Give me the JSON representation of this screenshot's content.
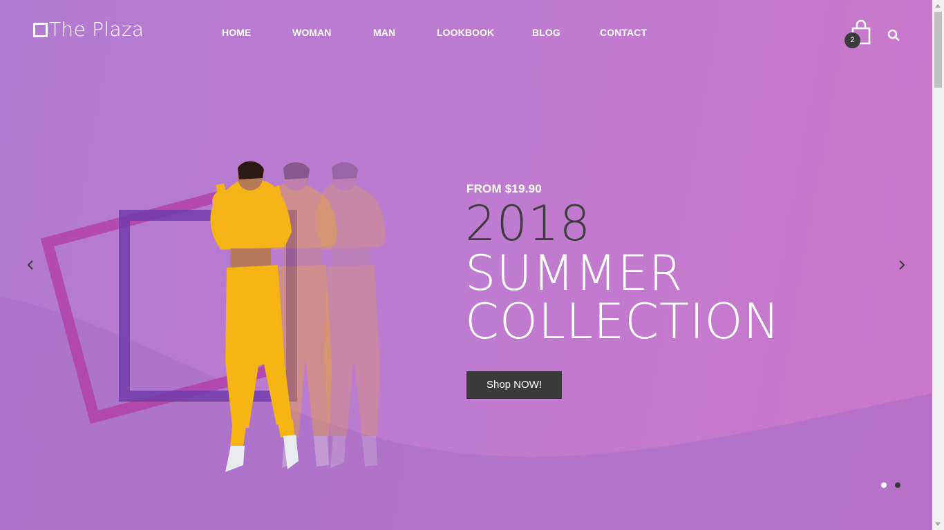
{
  "brand": {
    "name": "The Plaza"
  },
  "nav": {
    "items": [
      {
        "label": "HOME"
      },
      {
        "label": "WOMAN"
      },
      {
        "label": "MAN"
      },
      {
        "label": "LOOKBOOK"
      },
      {
        "label": "BLOG"
      },
      {
        "label": "CONTACT"
      }
    ]
  },
  "header": {
    "cart_icon": "shopping-bag-icon",
    "cart_count": "2",
    "search_icon": "search-icon"
  },
  "slide": {
    "price_text": "FROM $19.90",
    "year": "2018",
    "headline_line1": "SUMMER",
    "headline_line2": "COLLECTION",
    "cta_label": "Shop NOW!",
    "prev_icon": "chevron-left-icon",
    "next_icon": "chevron-right-icon",
    "dots_count": 2,
    "active_dot": 2
  },
  "colors": {
    "accent_dark": "#3a3a3a",
    "frame_magenta": "#b23ca8",
    "frame_purple": "#6f3aa6",
    "outfit_yellow": "#f4b316"
  }
}
